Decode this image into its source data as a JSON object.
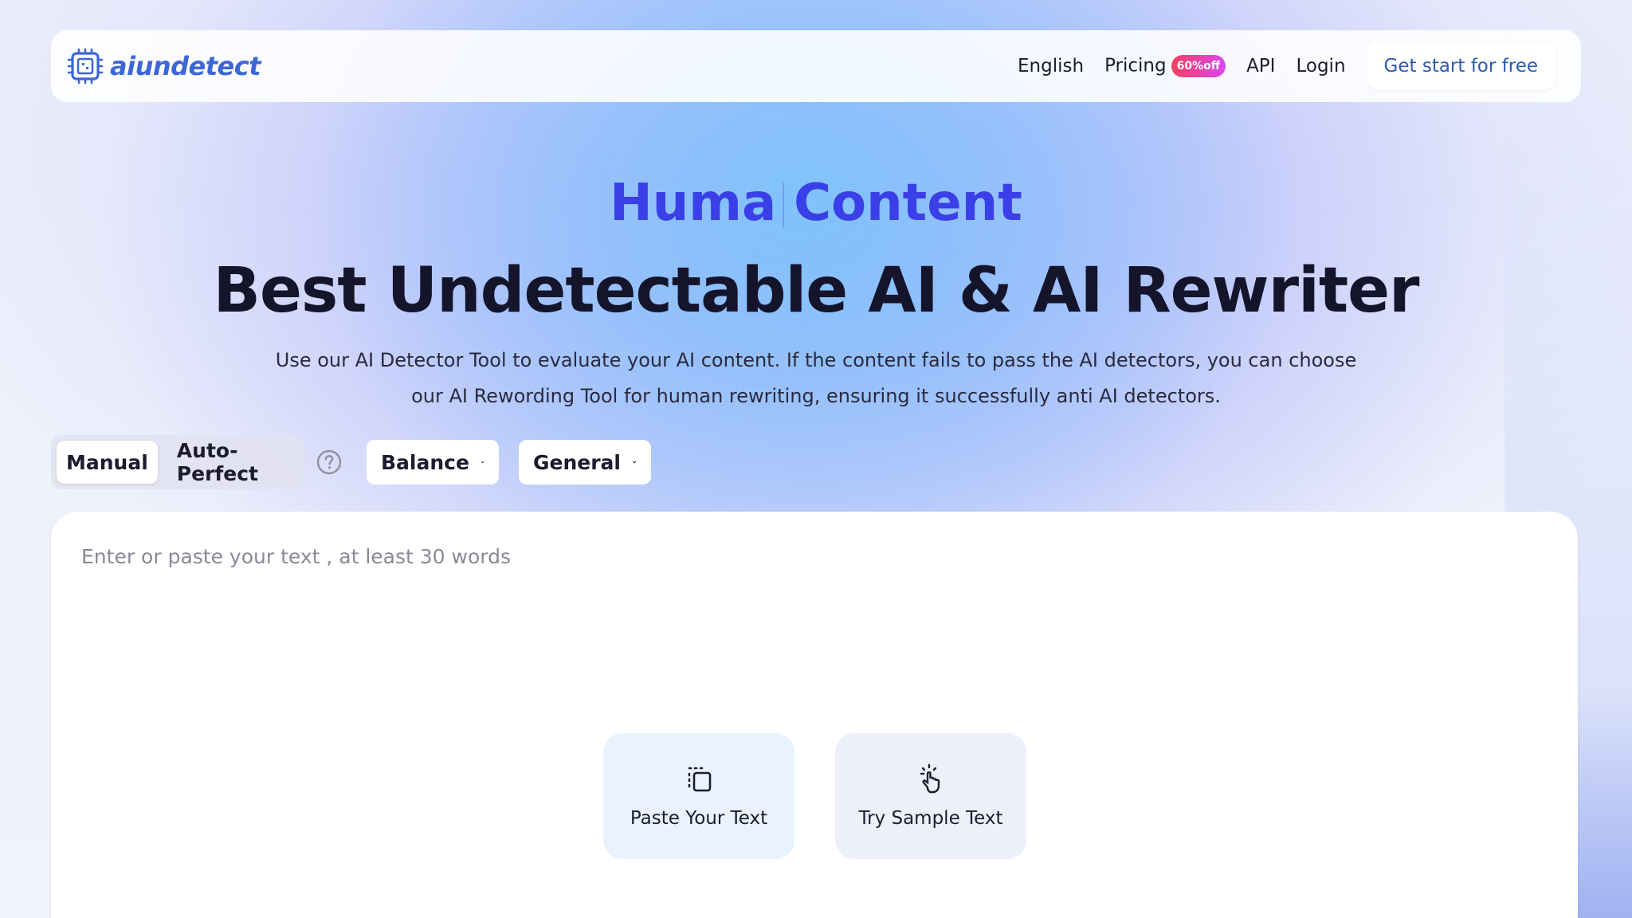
{
  "nav": {
    "logo_text": "aiundetect",
    "language": "English",
    "pricing": "Pricing",
    "pricing_badge": "60%off",
    "api": "API",
    "login": "Login",
    "cta": "Get start for free"
  },
  "hero": {
    "eyebrow_left": "Huma",
    "eyebrow_right": "Content",
    "title": "Best Undetectable AI & AI Rewriter",
    "subtitle": "Use our AI Detector Tool to evaluate your AI content. If the content fails to pass the AI detectors, you can choose our AI Rewording Tool for human rewriting, ensuring it successfully anti AI detectors."
  },
  "controls": {
    "mode_manual": "Manual",
    "mode_auto": "Auto-Perfect",
    "active_mode": "Manual",
    "help_icon": "question-circle-icon",
    "strength_dropdown": "Balance",
    "style_dropdown": "General"
  },
  "editor": {
    "placeholder": "Enter or paste your text , at least 30 words",
    "paste_label": "Paste Your Text",
    "paste_icon": "paste-icon",
    "sample_label": "Try Sample Text",
    "sample_icon": "tap-hand-icon"
  },
  "colors": {
    "brand_blue": "#3d66d6",
    "eyebrow_blue": "#3b3fe8",
    "badge_gradient_start": "#f43f5e",
    "badge_gradient_end": "#d946ef",
    "cta_text": "#2d5bb0"
  }
}
